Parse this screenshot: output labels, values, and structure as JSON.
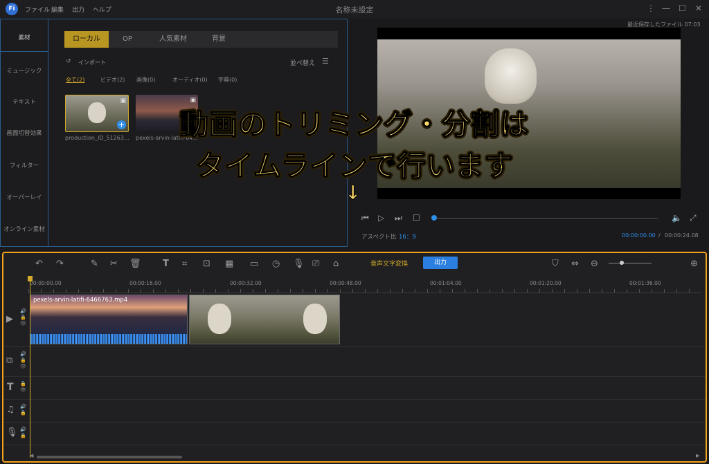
{
  "titlebar": {
    "logo": "Fi",
    "menu": [
      "ファイル",
      "編集",
      "出力",
      "ヘルプ"
    ],
    "title": "名称未設定",
    "controls": [
      "⋮",
      "—",
      "☐",
      "✕"
    ]
  },
  "sidebar": {
    "items": [
      "素材",
      "ミュージック",
      "テキスト",
      "画面切替効果",
      "フィルター",
      "オーバーレイ",
      "オンライン素材"
    ]
  },
  "library": {
    "tabs": [
      "ローカル",
      "OP",
      "人気素材",
      "背景"
    ],
    "import_label": "インポート",
    "sort_label": "並べ替え",
    "filters": [
      "全て(2)",
      "ビデオ(2)",
      "画像(0)",
      "オーディオ(0)",
      "字幕(0)"
    ],
    "items": [
      {
        "name": "production_ID_51263..."
      },
      {
        "name": "pexels-arvin-latifi-64..."
      }
    ]
  },
  "preview": {
    "last_saved": "最近保存したファイル 07:03",
    "aspect_label": "アスペクト比",
    "aspect_value": "16：9",
    "current_time": "00:00:00.00",
    "separator": "/",
    "total_time": "00:00:24.08"
  },
  "overlay": {
    "line1": "動画のトリミング・分割は",
    "line2": "タイムラインで行います",
    "arrow": "↓"
  },
  "timeline": {
    "speech_to_text": "音声文字変換",
    "export": "出力",
    "ruler": [
      "00:00:00.00",
      "00:00:16.00",
      "00:00:32.00",
      "00:00:48.00",
      "00:01:04.00",
      "00:01:20.00",
      "00:01:36.00"
    ],
    "clip1_name": "pexels-arvin-latifi-6466763.mp4",
    "zoom_level": 0.3
  },
  "colors": {
    "accent": "#b99622",
    "highlight": "#f0a31b",
    "export_blue": "#2a7fe0",
    "overlay_text": "#fbd86a"
  }
}
